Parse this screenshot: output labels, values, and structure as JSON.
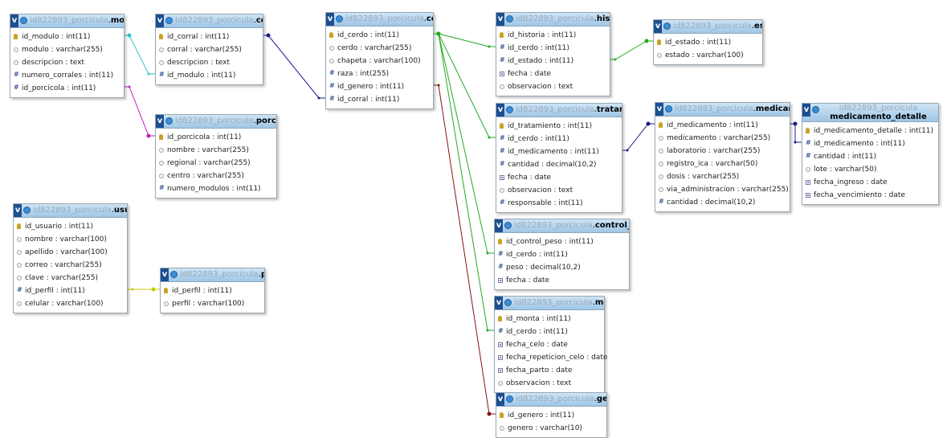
{
  "db_prefix": "id822893_porcicula",
  "icons": {
    "button_v": "v",
    "options": "options-icon",
    "key": "key-icon",
    "column": "column-icon",
    "numeric": "numeric-icon",
    "date": "date-icon"
  },
  "tables": [
    {
      "name": "modulo",
      "columns": [
        {
          "text": "id_modulo : int(11)",
          "icon": "key"
        },
        {
          "text": "modulo : varchar(255)",
          "icon": "col"
        },
        {
          "text": "descripcion : text",
          "icon": "col"
        },
        {
          "text": "numero_corrales : int(11)",
          "icon": "num"
        },
        {
          "text": "id_porcicola : int(11)",
          "icon": "num"
        }
      ]
    },
    {
      "name": "corral",
      "columns": [
        {
          "text": "id_corral : int(11)",
          "icon": "key"
        },
        {
          "text": "corral : varchar(255)",
          "icon": "col"
        },
        {
          "text": "descripcion : text",
          "icon": "col"
        },
        {
          "text": "id_modulo : int(11)",
          "icon": "num"
        }
      ]
    },
    {
      "name": "cerdo",
      "columns": [
        {
          "text": "id_cerdo : int(11)",
          "icon": "key"
        },
        {
          "text": "cerdo : varchar(255)",
          "icon": "col"
        },
        {
          "text": "chapeta : varchar(100)",
          "icon": "col"
        },
        {
          "text": "raza : int(255)",
          "icon": "num"
        },
        {
          "text": "id_genero : int(11)",
          "icon": "num"
        },
        {
          "text": "id_corral : int(11)",
          "icon": "num"
        }
      ]
    },
    {
      "name": "historia",
      "columns": [
        {
          "text": "id_historia : int(11)",
          "icon": "key"
        },
        {
          "text": "id_cerdo : int(11)",
          "icon": "num"
        },
        {
          "text": "id_estado : int(11)",
          "icon": "num"
        },
        {
          "text": "fecha : date",
          "icon": "date"
        },
        {
          "text": "observacion : text",
          "icon": "col"
        }
      ]
    },
    {
      "name": "estado",
      "columns": [
        {
          "text": "id_estado : int(11)",
          "icon": "key"
        },
        {
          "text": "estado : varchar(100)",
          "icon": "col"
        }
      ]
    },
    {
      "name": "porcicola",
      "columns": [
        {
          "text": "id_porcicola : int(11)",
          "icon": "key"
        },
        {
          "text": "nombre : varchar(255)",
          "icon": "col"
        },
        {
          "text": "regional : varchar(255)",
          "icon": "col"
        },
        {
          "text": "centro : varchar(255)",
          "icon": "col"
        },
        {
          "text": "numero_modulos : int(11)",
          "icon": "num"
        }
      ]
    },
    {
      "name": "tratamiento",
      "columns": [
        {
          "text": "id_tratamiento : int(11)",
          "icon": "key"
        },
        {
          "text": "id_cerdo : int(11)",
          "icon": "num"
        },
        {
          "text": "id_medicamento : int(11)",
          "icon": "num"
        },
        {
          "text": "cantidad : decimal(10,2)",
          "icon": "num"
        },
        {
          "text": "fecha : date",
          "icon": "date"
        },
        {
          "text": "observacion : text",
          "icon": "col"
        },
        {
          "text": "responsable : int(11)",
          "icon": "num"
        }
      ]
    },
    {
      "name": "medicamento",
      "columns": [
        {
          "text": "id_medicamento : int(11)",
          "icon": "key"
        },
        {
          "text": "medicamento : varchar(255)",
          "icon": "col"
        },
        {
          "text": "laboratorio : varchar(255)",
          "icon": "col"
        },
        {
          "text": "registro_ica : varchar(50)",
          "icon": "col"
        },
        {
          "text": "dosis : varchar(255)",
          "icon": "col"
        },
        {
          "text": "via_administracion : varchar(255)",
          "icon": "col"
        },
        {
          "text": "cantidad : decimal(10,2)",
          "icon": "num"
        }
      ]
    },
    {
      "name": "medicamento_detalle",
      "columns": [
        {
          "text": "id_medicamento_detalle : int(11)",
          "icon": "key"
        },
        {
          "text": "id_medicamento : int(11)",
          "icon": "num"
        },
        {
          "text": "cantidad : int(11)",
          "icon": "num"
        },
        {
          "text": "lote : varchar(50)",
          "icon": "col"
        },
        {
          "text": "fecha_ingreso : date",
          "icon": "date"
        },
        {
          "text": "fecha_vencimiento : date",
          "icon": "date"
        }
      ]
    },
    {
      "name": "usuario",
      "columns": [
        {
          "text": "id_usuario : int(11)",
          "icon": "key"
        },
        {
          "text": "nombre : varchar(100)",
          "icon": "col"
        },
        {
          "text": "apellido : varchar(100)",
          "icon": "col"
        },
        {
          "text": "correo : varchar(255)",
          "icon": "col"
        },
        {
          "text": "clave : varchar(255)",
          "icon": "col"
        },
        {
          "text": "id_perfil : int(11)",
          "icon": "num"
        },
        {
          "text": "celular : varchar(100)",
          "icon": "col"
        }
      ]
    },
    {
      "name": "perfil",
      "columns": [
        {
          "text": "id_perfil : int(11)",
          "icon": "key"
        },
        {
          "text": "perfil : varchar(100)",
          "icon": "col"
        }
      ]
    },
    {
      "name": "control_peso",
      "columns": [
        {
          "text": "id_control_peso : int(11)",
          "icon": "key"
        },
        {
          "text": "id_cerdo : int(11)",
          "icon": "num"
        },
        {
          "text": "peso : decimal(10,2)",
          "icon": "num"
        },
        {
          "text": "fecha : date",
          "icon": "date"
        }
      ]
    },
    {
      "name": "monta",
      "columns": [
        {
          "text": "id_monta : int(11)",
          "icon": "key"
        },
        {
          "text": "id_cerdo : int(11)",
          "icon": "num"
        },
        {
          "text": "fecha_celo : date",
          "icon": "date"
        },
        {
          "text": "fecha_repeticion_celo : date",
          "icon": "date"
        },
        {
          "text": "fecha_parto : date",
          "icon": "date"
        },
        {
          "text": "observacion : text",
          "icon": "col"
        }
      ]
    },
    {
      "name": "genero",
      "columns": [
        {
          "text": "id_genero : int(11)",
          "icon": "key"
        },
        {
          "text": "genero : varchar(10)",
          "icon": "col"
        }
      ]
    }
  ],
  "relations": [
    {
      "from": "modulo",
      "to": "corral",
      "color": "#2fc7c7"
    },
    {
      "from": "porcicola",
      "to": "modulo",
      "color": "#c020c0"
    },
    {
      "from": "corral",
      "to": "cerdo",
      "color": "#1a1a8c"
    },
    {
      "from": "cerdo",
      "to": "historia",
      "color": "#22aa22"
    },
    {
      "from": "cerdo",
      "to": "tratamiento",
      "color": "#22aa22"
    },
    {
      "from": "cerdo",
      "to": "control_peso",
      "color": "#22aa22"
    },
    {
      "from": "cerdo",
      "to": "monta",
      "color": "#22aa22"
    },
    {
      "from": "genero",
      "to": "cerdo",
      "color": "#8b1010"
    },
    {
      "from": "estado",
      "to": "historia",
      "color": "#22aa22"
    },
    {
      "from": "medicamento",
      "to": "tratamiento",
      "color": "#1a1a8c"
    },
    {
      "from": "medicamento",
      "to": "medicamento_detalle",
      "color": "#1a1a8c"
    },
    {
      "from": "perfil",
      "to": "usuario",
      "color": "#c8c800"
    }
  ]
}
